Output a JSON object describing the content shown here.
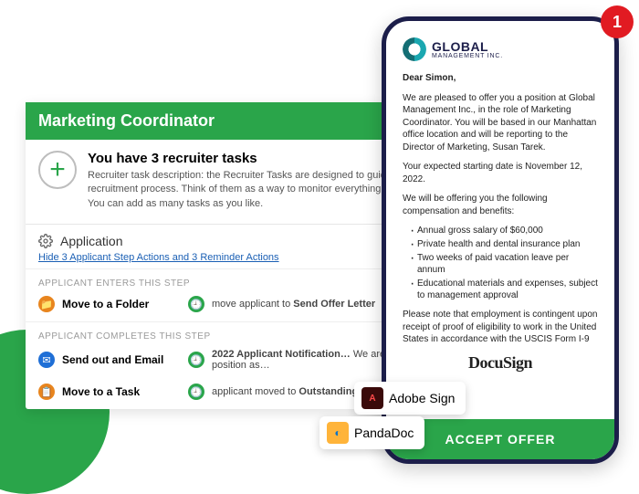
{
  "card": {
    "title": "Marketing Coordinator",
    "tasks_title": "You have 3 recruiter tasks",
    "tasks_desc": "Recruiter task description: the Recruiter Tasks are designed to guide you through the recruitment process. Think of them as a way to monitor everything that happens step by step. You can add as many tasks as you like.",
    "section_title": "Application",
    "hide_link": "Hide 3 Applicant Step Actions and 3 Reminder Actions",
    "enters_heading": "APPLICANT ENTERS THIS STEP",
    "completes_heading": "APPLICANT COMPLETES THIS STEP",
    "actions": {
      "move_folder": {
        "name": "Move to a Folder",
        "detail_prefix": "move applicant to ",
        "detail_bold": "Send Offer Letter"
      },
      "send_email": {
        "name": "Send out and Email",
        "detail_prefix": "2022 Applicant Notification… ",
        "detail_rest": "We are pleased to offer you a position as…"
      },
      "move_task": {
        "name": "Move to a Task",
        "detail_prefix": "applicant moved to ",
        "detail_bold": "Outstanding offer"
      }
    }
  },
  "tags": {
    "adobe": "Adobe Sign",
    "panda": "PandaDoc"
  },
  "phone": {
    "badge": "1",
    "logo_big": "GLOBAL",
    "logo_small": "MANAGEMENT INC.",
    "greeting": "Dear Simon,",
    "p1": "We are pleased to offer you a position at Global Management Inc., in the role of Marketing Coordinator. You will be based in our Manhattan office location and will be reporting to the Director of Marketing, Susan Tarek.",
    "p2": "Your expected starting date is November 12, 2022.",
    "p3": "We will be offering you the following compensation and benefits:",
    "bullets": [
      "Annual gross salary of $60,000",
      "Private health and dental insurance plan",
      "Two weeks of paid vacation leave per annum",
      "Educational materials and expenses, subject to management approval"
    ],
    "p4": "Please note that employment is contingent upon receipt of proof of eligibility to work in the United States in accordance with the USCIS Form I-9",
    "docusign": "DocuSign",
    "accept": "ACCEPT OFFER"
  }
}
